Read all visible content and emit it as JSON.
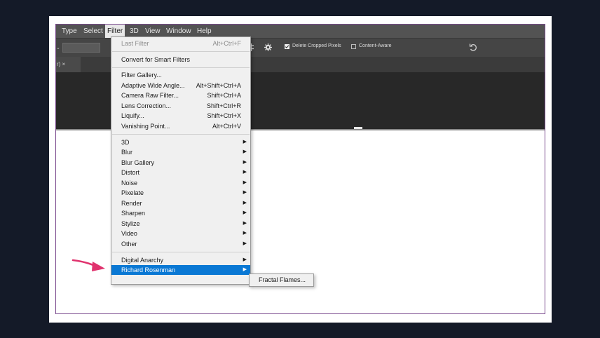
{
  "menubar": {
    "items": [
      "Type",
      "Select",
      "Filter",
      "3D",
      "View",
      "Window",
      "Help"
    ]
  },
  "options": {
    "delete_cropped": "Delete Cropped Pixels",
    "content_aware": "Content-Aware"
  },
  "tab": {
    "label": "r) ×"
  },
  "filter_menu": {
    "last_filter": {
      "label": "Last Filter",
      "shortcut": "Alt+Ctrl+F"
    },
    "convert": "Convert for Smart Filters",
    "items": [
      {
        "label": "Filter Gallery...",
        "shortcut": ""
      },
      {
        "label": "Adaptive Wide Angle...",
        "shortcut": "Alt+Shift+Ctrl+A"
      },
      {
        "label": "Camera Raw Filter...",
        "shortcut": "Shift+Ctrl+A"
      },
      {
        "label": "Lens Correction...",
        "shortcut": "Shift+Ctrl+R"
      },
      {
        "label": "Liquify...",
        "shortcut": "Shift+Ctrl+X"
      },
      {
        "label": "Vanishing Point...",
        "shortcut": "Alt+Ctrl+V"
      }
    ],
    "groups": [
      "3D",
      "Blur",
      "Blur Gallery",
      "Distort",
      "Noise",
      "Pixelate",
      "Render",
      "Sharpen",
      "Stylize",
      "Video",
      "Other"
    ],
    "plugins": [
      "Digital Anarchy",
      "Richard Rosenman"
    ]
  },
  "submenu": {
    "item": "Fractal Flames..."
  },
  "colors": {
    "highlight": "#0a78d4",
    "arrow": "#e0336e",
    "window_border": "#7a4a8e"
  }
}
